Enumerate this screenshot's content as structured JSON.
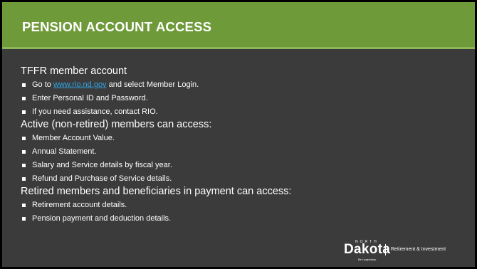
{
  "slide": {
    "title": "PENSION ACCOUNT ACCESS"
  },
  "sections": [
    {
      "heading": "TFFR member account",
      "items": [
        {
          "before": "Go to ",
          "link": "www.rio.nd.gov",
          "after": " and select Member Login."
        },
        {
          "text": "Enter Personal ID and Password."
        },
        {
          "text": "If you need assistance, contact RIO."
        }
      ]
    },
    {
      "heading": "Active (non-retired) members can access:",
      "items": [
        {
          "text": "Member Account Value."
        },
        {
          "text": "Annual Statement."
        },
        {
          "text": "Salary and Service details by fiscal year."
        },
        {
          "text": "Refund and Purchase of Service details."
        }
      ]
    },
    {
      "heading": "Retired members and beneficiaries in payment can access:",
      "items": [
        {
          "text": "Retirement account details."
        },
        {
          "text": "Pension payment and deduction details."
        }
      ]
    }
  ],
  "logo": {
    "north": "NORTH",
    "dakota": "Dakota",
    "tagline": "Be Legendary.",
    "division": "Retirement & Investment"
  },
  "colors": {
    "title_bar": "#6f9a3a",
    "background": "#3b3b3b",
    "link": "#2fa6e8"
  }
}
